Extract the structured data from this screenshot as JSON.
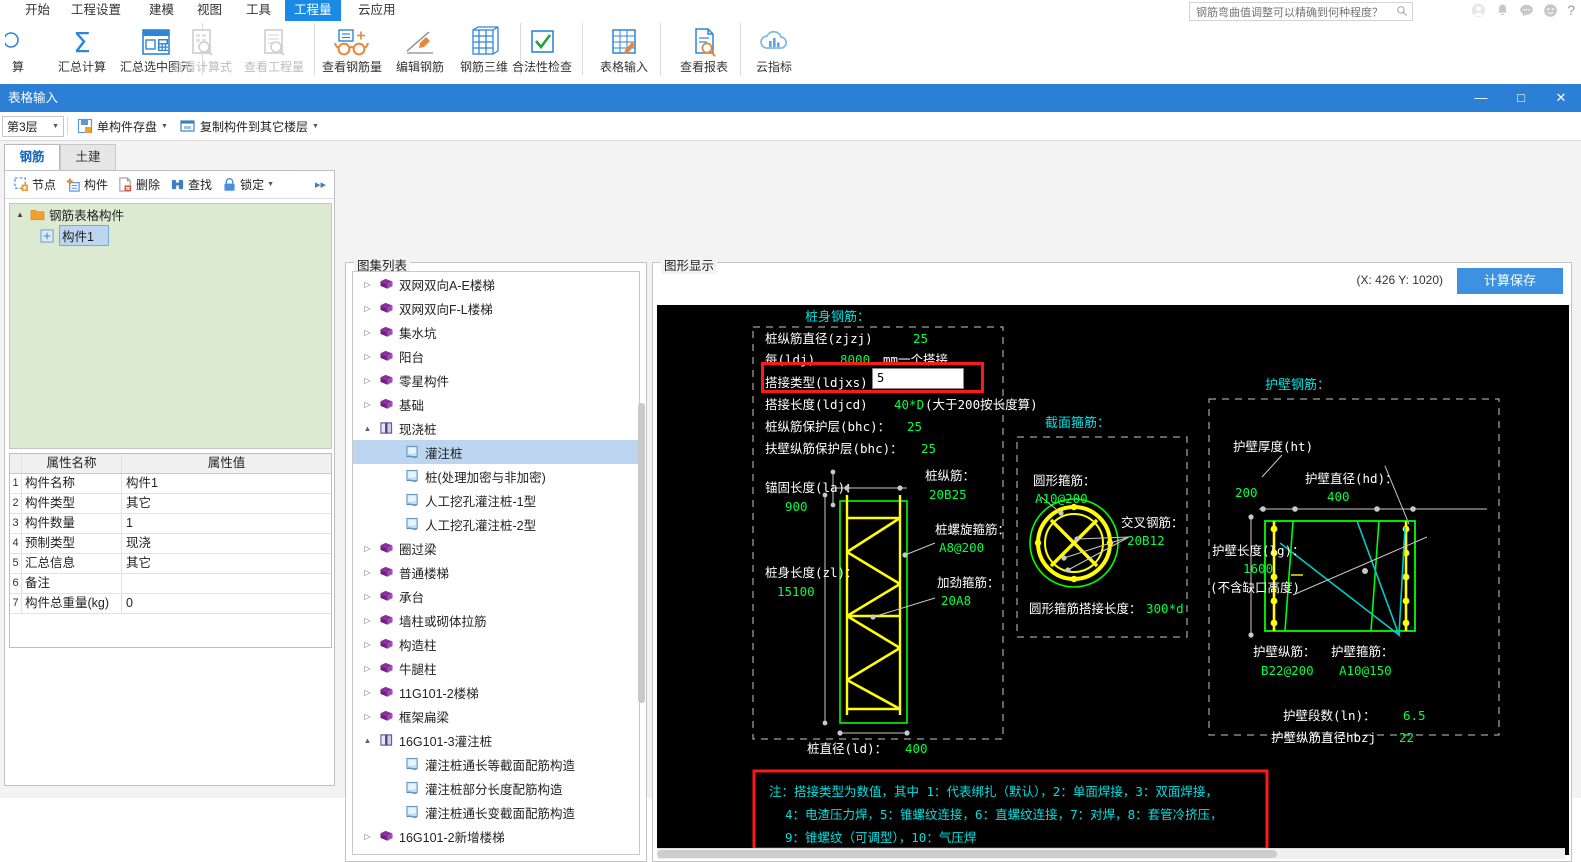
{
  "menubar": {
    "items": [
      {
        "label": "开始",
        "active": false
      },
      {
        "label": "工程设置",
        "active": false
      },
      {
        "label": "建模",
        "active": false
      },
      {
        "label": "视图",
        "active": false
      },
      {
        "label": "工具",
        "active": false
      },
      {
        "label": "工程量",
        "active": true
      },
      {
        "label": "云应用",
        "active": false
      }
    ]
  },
  "search": {
    "placeholder": "钢筋弯曲值调整可以精确到何种程度？",
    "value": "",
    "icon": "search-icon"
  },
  "topicons": [
    {
      "name": "account-icon",
      "glyph": "account"
    },
    {
      "name": "notification-bell-icon",
      "glyph": "bell"
    },
    {
      "name": "chat-bubble-icon",
      "glyph": "chat"
    },
    {
      "name": "smiley-face-icon",
      "glyph": "smiley"
    },
    {
      "name": "help-question-icon",
      "glyph": "?"
    }
  ],
  "ribbon": {
    "groups": [
      {
        "buttons": [
          {
            "label": "算",
            "icon": "partial-icon",
            "disabled": false,
            "truncated": true
          },
          {
            "label": "汇总计算",
            "icon": "sigma-icon",
            "disabled": false
          },
          {
            "label": "汇总选中图元",
            "icon": "table-select-icon",
            "disabled": false
          }
        ]
      },
      {
        "buttons": [
          {
            "label": "查看计算式",
            "icon": "view-formula-icon",
            "disabled": true
          },
          {
            "label": "查看工程量",
            "icon": "view-quantity-icon",
            "disabled": true
          }
        ]
      },
      {
        "buttons": [
          {
            "label": "查看钢筋量",
            "icon": "glasses-rebar-icon",
            "disabled": false
          },
          {
            "label": "编辑钢筋",
            "icon": "pencil-edit-icon",
            "disabled": false
          },
          {
            "label": "钢筋三维",
            "icon": "rebar-3d-icon",
            "disabled": false
          }
        ]
      },
      {
        "buttons": [
          {
            "label": "合法性检查",
            "icon": "checkbox-check-icon",
            "disabled": false
          }
        ]
      },
      {
        "buttons": [
          {
            "label": "表格输入",
            "icon": "table-input-icon",
            "disabled": false
          }
        ]
      },
      {
        "buttons": [
          {
            "label": "查看报表",
            "icon": "report-search-icon",
            "disabled": false
          }
        ]
      },
      {
        "buttons": [
          {
            "label": "云指标",
            "icon": "cloud-chart-icon",
            "disabled": false
          }
        ]
      }
    ]
  },
  "subwindow": {
    "title": "表格输入",
    "controls": [
      {
        "name": "minimize-button",
        "glyph": "—"
      },
      {
        "name": "maximize-button",
        "glyph": "□"
      },
      {
        "name": "close-button",
        "glyph": "✕"
      }
    ],
    "toolbar": {
      "floor": "第3层",
      "save_component": "单构件存盘",
      "copy_component": "复制构件到其它楼层"
    },
    "tabs": [
      {
        "label": "钢筋",
        "selected": true
      },
      {
        "label": "土建",
        "selected": false
      }
    ]
  },
  "left_panel": {
    "toolbar": [
      {
        "label": "节点",
        "icon": "node-add-icon"
      },
      {
        "label": "构件",
        "icon": "component-add-icon"
      },
      {
        "label": "删除",
        "icon": "delete-icon"
      },
      {
        "label": "查找",
        "icon": "find-binocular-icon"
      },
      {
        "label": "锁定",
        "icon": "lock-icon",
        "caret": true
      },
      {
        "label": "",
        "icon": "more-chevron-icon"
      }
    ],
    "tree": [
      {
        "label": "钢筋表格构件",
        "level": 0,
        "icon": "folder-icon",
        "expander": "▲",
        "selected": false
      },
      {
        "label": "构件1",
        "level": 1,
        "icon": "component-icon",
        "expander": "",
        "selected": true
      }
    ],
    "properties": {
      "headers": [
        "",
        "属性名称",
        "属性值"
      ],
      "rows": [
        {
          "index": "1",
          "name": "构件名称",
          "value": "构件1"
        },
        {
          "index": "2",
          "name": "构件类型",
          "value": "其它"
        },
        {
          "index": "3",
          "name": "构件数量",
          "value": "1"
        },
        {
          "index": "4",
          "name": "预制类型",
          "value": "现浇"
        },
        {
          "index": "5",
          "name": "汇总信息",
          "value": "其它"
        },
        {
          "index": "6",
          "name": "备注",
          "value": ""
        },
        {
          "index": "7",
          "name": "构件总重量(kg)",
          "value": "0"
        }
      ]
    }
  },
  "atlas_panel": {
    "title": "图集列表",
    "items": [
      {
        "label": "双网双向A-E楼梯",
        "level": 0,
        "expander": "▷",
        "icon": "book-icon",
        "selected": false
      },
      {
        "label": "双网双向F-L楼梯",
        "level": 0,
        "expander": "▷",
        "icon": "book-icon",
        "selected": false
      },
      {
        "label": "集水坑",
        "level": 0,
        "expander": "▷",
        "icon": "book-icon",
        "selected": false
      },
      {
        "label": "阳台",
        "level": 0,
        "expander": "▷",
        "icon": "book-icon",
        "selected": false
      },
      {
        "label": "零星构件",
        "level": 0,
        "expander": "▷",
        "icon": "book-icon",
        "selected": false
      },
      {
        "label": "基础",
        "level": 0,
        "expander": "▷",
        "icon": "book-icon",
        "selected": false
      },
      {
        "label": "现浇桩",
        "level": 0,
        "expander": "▲",
        "icon": "book-open-icon",
        "selected": false
      },
      {
        "label": "灌注桩",
        "level": 1,
        "expander": "",
        "icon": "page-icon",
        "selected": true
      },
      {
        "label": "桩(处理加密与非加密)",
        "level": 1,
        "expander": "",
        "icon": "page-icon",
        "selected": false
      },
      {
        "label": "人工挖孔灌注桩-1型",
        "level": 1,
        "expander": "",
        "icon": "page-icon",
        "selected": false
      },
      {
        "label": "人工挖孔灌注桩-2型",
        "level": 1,
        "expander": "",
        "icon": "page-icon",
        "selected": false
      },
      {
        "label": "圈过梁",
        "level": 0,
        "expander": "▷",
        "icon": "book-icon",
        "selected": false
      },
      {
        "label": "普通楼梯",
        "level": 0,
        "expander": "▷",
        "icon": "book-icon",
        "selected": false
      },
      {
        "label": "承台",
        "level": 0,
        "expander": "▷",
        "icon": "book-icon",
        "selected": false
      },
      {
        "label": "墙柱或砌体拉筋",
        "level": 0,
        "expander": "▷",
        "icon": "book-icon",
        "selected": false
      },
      {
        "label": "构造柱",
        "level": 0,
        "expander": "▷",
        "icon": "book-icon",
        "selected": false
      },
      {
        "label": "牛腿柱",
        "level": 0,
        "expander": "▷",
        "icon": "book-icon",
        "selected": false
      },
      {
        "label": "11G101-2楼梯",
        "level": 0,
        "expander": "▷",
        "icon": "book-icon",
        "selected": false
      },
      {
        "label": "框架扁梁",
        "level": 0,
        "expander": "▷",
        "icon": "book-icon",
        "selected": false
      },
      {
        "label": "16G101-3灌注桩",
        "level": 0,
        "expander": "▲",
        "icon": "book-open-icon",
        "selected": false
      },
      {
        "label": "灌注桩通长等截面配筋构造",
        "level": 1,
        "expander": "",
        "icon": "page-icon",
        "selected": false
      },
      {
        "label": "灌注桩部分长度配筋构造",
        "level": 1,
        "expander": "",
        "icon": "page-icon",
        "selected": false
      },
      {
        "label": "灌注桩通长变截面配筋构造",
        "level": 1,
        "expander": "",
        "icon": "page-icon",
        "selected": false
      },
      {
        "label": "16G101-2新增楼梯",
        "level": 0,
        "expander": "▷",
        "icon": "book-icon",
        "selected": false
      }
    ]
  },
  "graphics_panel": {
    "title": "图形显示",
    "coordinates": "(X: 426 Y: 1020)",
    "calc_save_button": "计算保存",
    "colors": {
      "background": "#000000",
      "heading": "#00e0e0",
      "label": "#ffffff",
      "value": "#00ff40",
      "rebar": "#ffff00",
      "outline": "#00ff00",
      "dim": "#c8c8c8",
      "highlight": "#ff0000",
      "cyan": "#00cccc"
    },
    "pile_body": {
      "heading": "桩身钢筋：",
      "params": [
        {
          "label": "桩纵筋直径(zjzj)",
          "value": "25"
        },
        {
          "label": "每(ldj)",
          "value": "8000",
          "suffix": "mm一个搭接"
        },
        {
          "label": "搭接类型(ldjxs)",
          "value": "5",
          "editing": true
        },
        {
          "label": "搭接长度(ldjcd)",
          "value": "40*D",
          "suffix": "(大于200按长度算)"
        },
        {
          "label": "桩纵筋保护层(bhc)",
          "value": "25"
        },
        {
          "label": "扶壁纵筋保护层(bhc)",
          "value": "25"
        }
      ],
      "anchor_label": "锚固长度(la)",
      "anchor_value": "900",
      "longitudinal_label": "桩纵筋：",
      "longitudinal_value": "20B25",
      "spiral_label": "桩螺旋箍筋：",
      "spiral_value": "A8@200",
      "stiffener_label": "加劲箍筋：",
      "stiffener_value": "20A8",
      "length_label": "桩身长度(zl)：",
      "length_value": "15100",
      "diameter_label": "桩直径(ld)：",
      "diameter_value": "400"
    },
    "section_stirrup": {
      "heading": "截面箍筋：",
      "circular_label": "圆形箍筋：",
      "circular_value": "A10@200",
      "cross_label": "交叉钢筋：",
      "cross_value": "20B12",
      "lap_label": "圆形箍筋搭接长度：",
      "lap_value": "300*d"
    },
    "wall_rebar": {
      "heading": "护壁钢筋：",
      "thickness_label": "护壁厚度(ht)",
      "thickness_value": "200",
      "diameter_label": "护壁直径(hd)：",
      "diameter_value": "400",
      "length_label": "护壁长度(lg)：",
      "length_value": "1600",
      "length_note": "(不含缺口高度)",
      "longitudinal_label": "护壁纵筋：",
      "longitudinal_value": "B22@200",
      "stirrup_label": "护壁箍筋：",
      "stirrup_value": "A10@150",
      "segments_label": "护壁段数(ln)：",
      "segments_value": "6.5",
      "rebar_dia_label": "护壁纵筋直径hbzj",
      "rebar_dia_value": "22"
    },
    "note": {
      "line1": "注：搭接类型为数值，其中 1：代表绑扎（默认），2：单面焊接，3：双面焊接，",
      "line2": "4：电渣压力焊，5：锥螺纹连接，6：直螺纹连接，7：对焊，8：套管冷挤压，",
      "line3": "9：锥螺纹（可调型），10：气压焊"
    }
  }
}
